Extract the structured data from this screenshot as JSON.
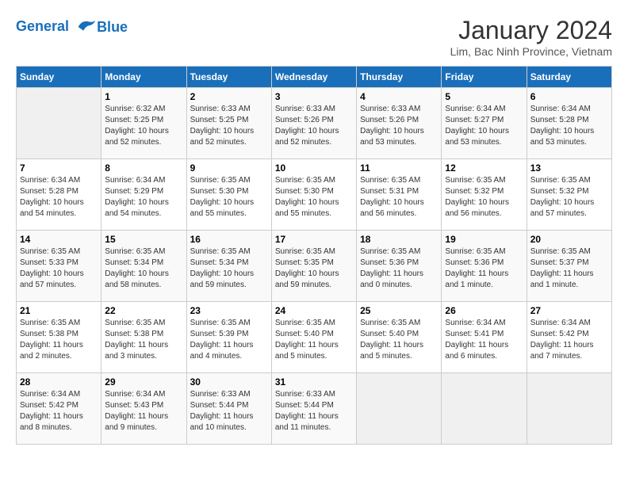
{
  "header": {
    "logo_line1": "General",
    "logo_line2": "Blue",
    "month_title": "January 2024",
    "location": "Lim, Bac Ninh Province, Vietnam"
  },
  "weekdays": [
    "Sunday",
    "Monday",
    "Tuesday",
    "Wednesday",
    "Thursday",
    "Friday",
    "Saturday"
  ],
  "weeks": [
    [
      {
        "day": "",
        "info": ""
      },
      {
        "day": "1",
        "info": "Sunrise: 6:32 AM\nSunset: 5:25 PM\nDaylight: 10 hours\nand 52 minutes."
      },
      {
        "day": "2",
        "info": "Sunrise: 6:33 AM\nSunset: 5:25 PM\nDaylight: 10 hours\nand 52 minutes."
      },
      {
        "day": "3",
        "info": "Sunrise: 6:33 AM\nSunset: 5:26 PM\nDaylight: 10 hours\nand 52 minutes."
      },
      {
        "day": "4",
        "info": "Sunrise: 6:33 AM\nSunset: 5:26 PM\nDaylight: 10 hours\nand 53 minutes."
      },
      {
        "day": "5",
        "info": "Sunrise: 6:34 AM\nSunset: 5:27 PM\nDaylight: 10 hours\nand 53 minutes."
      },
      {
        "day": "6",
        "info": "Sunrise: 6:34 AM\nSunset: 5:28 PM\nDaylight: 10 hours\nand 53 minutes."
      }
    ],
    [
      {
        "day": "7",
        "info": "Sunrise: 6:34 AM\nSunset: 5:28 PM\nDaylight: 10 hours\nand 54 minutes."
      },
      {
        "day": "8",
        "info": "Sunrise: 6:34 AM\nSunset: 5:29 PM\nDaylight: 10 hours\nand 54 minutes."
      },
      {
        "day": "9",
        "info": "Sunrise: 6:35 AM\nSunset: 5:30 PM\nDaylight: 10 hours\nand 55 minutes."
      },
      {
        "day": "10",
        "info": "Sunrise: 6:35 AM\nSunset: 5:30 PM\nDaylight: 10 hours\nand 55 minutes."
      },
      {
        "day": "11",
        "info": "Sunrise: 6:35 AM\nSunset: 5:31 PM\nDaylight: 10 hours\nand 56 minutes."
      },
      {
        "day": "12",
        "info": "Sunrise: 6:35 AM\nSunset: 5:32 PM\nDaylight: 10 hours\nand 56 minutes."
      },
      {
        "day": "13",
        "info": "Sunrise: 6:35 AM\nSunset: 5:32 PM\nDaylight: 10 hours\nand 57 minutes."
      }
    ],
    [
      {
        "day": "14",
        "info": "Sunrise: 6:35 AM\nSunset: 5:33 PM\nDaylight: 10 hours\nand 57 minutes."
      },
      {
        "day": "15",
        "info": "Sunrise: 6:35 AM\nSunset: 5:34 PM\nDaylight: 10 hours\nand 58 minutes."
      },
      {
        "day": "16",
        "info": "Sunrise: 6:35 AM\nSunset: 5:34 PM\nDaylight: 10 hours\nand 59 minutes."
      },
      {
        "day": "17",
        "info": "Sunrise: 6:35 AM\nSunset: 5:35 PM\nDaylight: 10 hours\nand 59 minutes."
      },
      {
        "day": "18",
        "info": "Sunrise: 6:35 AM\nSunset: 5:36 PM\nDaylight: 11 hours\nand 0 minutes."
      },
      {
        "day": "19",
        "info": "Sunrise: 6:35 AM\nSunset: 5:36 PM\nDaylight: 11 hours\nand 1 minute."
      },
      {
        "day": "20",
        "info": "Sunrise: 6:35 AM\nSunset: 5:37 PM\nDaylight: 11 hours\nand 1 minute."
      }
    ],
    [
      {
        "day": "21",
        "info": "Sunrise: 6:35 AM\nSunset: 5:38 PM\nDaylight: 11 hours\nand 2 minutes."
      },
      {
        "day": "22",
        "info": "Sunrise: 6:35 AM\nSunset: 5:38 PM\nDaylight: 11 hours\nand 3 minutes."
      },
      {
        "day": "23",
        "info": "Sunrise: 6:35 AM\nSunset: 5:39 PM\nDaylight: 11 hours\nand 4 minutes."
      },
      {
        "day": "24",
        "info": "Sunrise: 6:35 AM\nSunset: 5:40 PM\nDaylight: 11 hours\nand 5 minutes."
      },
      {
        "day": "25",
        "info": "Sunrise: 6:35 AM\nSunset: 5:40 PM\nDaylight: 11 hours\nand 5 minutes."
      },
      {
        "day": "26",
        "info": "Sunrise: 6:34 AM\nSunset: 5:41 PM\nDaylight: 11 hours\nand 6 minutes."
      },
      {
        "day": "27",
        "info": "Sunrise: 6:34 AM\nSunset: 5:42 PM\nDaylight: 11 hours\nand 7 minutes."
      }
    ],
    [
      {
        "day": "28",
        "info": "Sunrise: 6:34 AM\nSunset: 5:42 PM\nDaylight: 11 hours\nand 8 minutes."
      },
      {
        "day": "29",
        "info": "Sunrise: 6:34 AM\nSunset: 5:43 PM\nDaylight: 11 hours\nand 9 minutes."
      },
      {
        "day": "30",
        "info": "Sunrise: 6:33 AM\nSunset: 5:44 PM\nDaylight: 11 hours\nand 10 minutes."
      },
      {
        "day": "31",
        "info": "Sunrise: 6:33 AM\nSunset: 5:44 PM\nDaylight: 11 hours\nand 11 minutes."
      },
      {
        "day": "",
        "info": ""
      },
      {
        "day": "",
        "info": ""
      },
      {
        "day": "",
        "info": ""
      }
    ]
  ]
}
